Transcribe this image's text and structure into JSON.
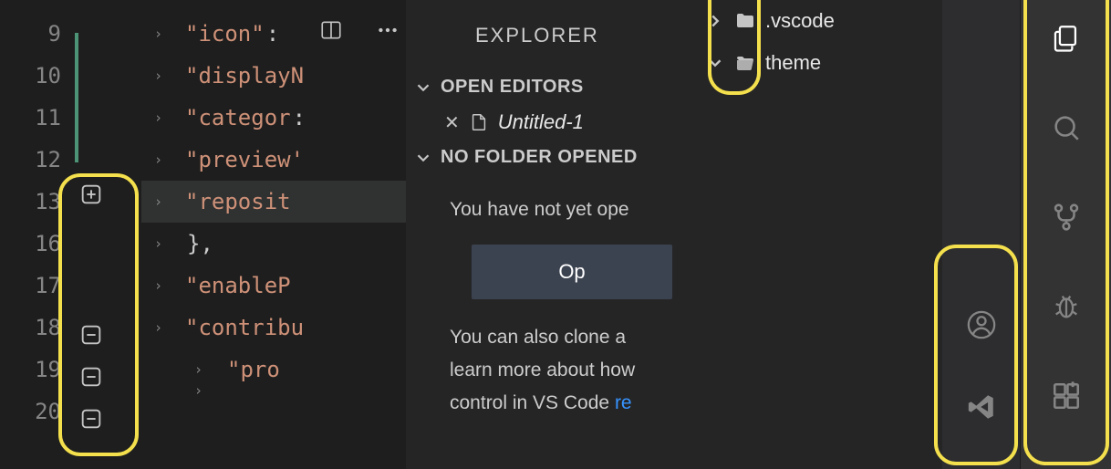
{
  "editor": {
    "lines": [
      {
        "num": 9,
        "indent": 1,
        "key": "\"icon\"",
        "suffix": ":"
      },
      {
        "num": 10,
        "indent": 1,
        "key": "\"displayN",
        "suffix": ""
      },
      {
        "num": 11,
        "indent": 1,
        "key": "\"categor",
        "suffix": ":"
      },
      {
        "num": 12,
        "indent": 1,
        "key": "\"preview'",
        "suffix": ""
      },
      {
        "num": 13,
        "indent": 1,
        "key": "\"reposit",
        "suffix": "",
        "current": true
      },
      {
        "num": 16,
        "indent": 1,
        "key": "",
        "suffix": "},"
      },
      {
        "num": 17,
        "indent": 1,
        "key": "\"enableP",
        "suffix": ":"
      },
      {
        "num": 18,
        "indent": 1,
        "key": "\"contribu",
        "suffix": ""
      },
      {
        "num": 19,
        "indent": 2,
        "key": "\"pro",
        "suffix": ""
      },
      {
        "num": 20,
        "indent": 2,
        "key": "",
        "suffix": ""
      }
    ]
  },
  "explorer": {
    "title": "EXPLORER",
    "openEditorsHeader": "OPEN EDITORS",
    "openEditorItem": "Untitled-1",
    "noFolderHeader": "NO FOLDER OPENED",
    "noFolderLine1": "You have not yet ope",
    "openButton": "Op",
    "noFolderLine2a": "You can also clone a ",
    "noFolderLine2b": "learn more about how",
    "noFolderLine2c_prefix": "control in VS Code ",
    "noFolderLine2c_link": "re"
  },
  "folderPopover": {
    "items": [
      {
        "name": ".vscode",
        "expanded": false,
        "color": "blue"
      },
      {
        "name": "theme",
        "expanded": true,
        "color": "orange"
      }
    ]
  },
  "miniActs": {
    "icons": [
      "account-icon",
      "vs-icon"
    ]
  },
  "activityBar": {
    "icons": [
      "files-icon",
      "search-icon",
      "source-control-icon",
      "bug-icon",
      "extensions-icon"
    ]
  }
}
